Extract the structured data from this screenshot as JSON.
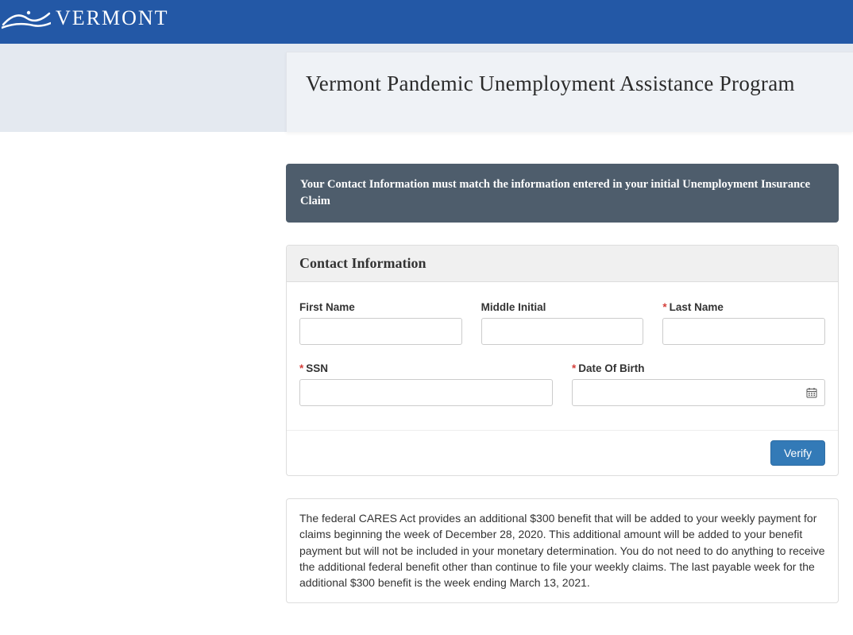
{
  "header": {
    "brand_text": "VERMONT"
  },
  "page": {
    "title": "Vermont Pandemic Unemployment Assistance Program"
  },
  "notice": {
    "text": "Your Contact Information must match the information entered in your initial Unemployment Insurance Claim"
  },
  "form": {
    "section_title": "Contact Information",
    "fields": {
      "first_name": {
        "label": "First Name",
        "required": false,
        "value": ""
      },
      "middle_initial": {
        "label": "Middle Initial",
        "required": false,
        "value": ""
      },
      "last_name": {
        "label": "Last Name",
        "required": true,
        "value": ""
      },
      "ssn": {
        "label": "SSN",
        "required": true,
        "value": ""
      },
      "dob": {
        "label": "Date Of Birth",
        "required": true,
        "value": ""
      }
    },
    "verify_button": "Verify"
  },
  "info": {
    "text": "The federal CARES Act provides an additional $300 benefit that will be added to your weekly payment for claims beginning the week of December 28, 2020. This additional amount will be added to your benefit payment but will not be included in your monetary determination. You do not need to do anything to receive the additional federal benefit other than continue to file your weekly claims. The last payable week for the additional $300 benefit is the week ending March 13, 2021."
  }
}
